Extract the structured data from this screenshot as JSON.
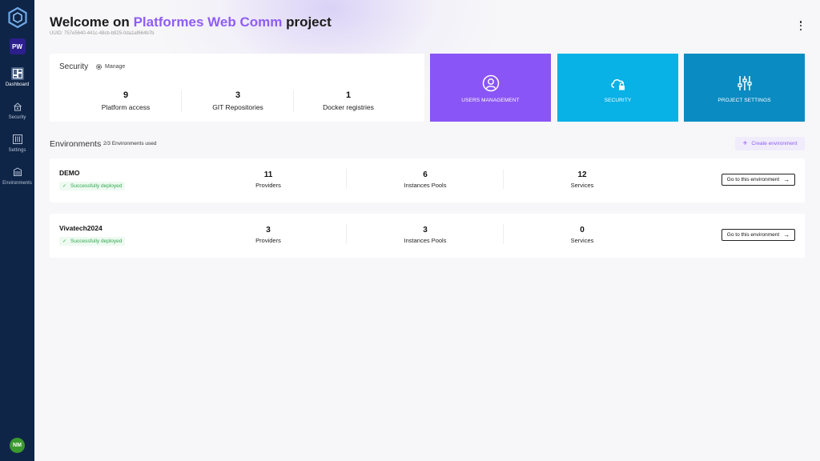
{
  "sidebar": {
    "project_initials": "PW",
    "items": [
      {
        "label": "Dashboard",
        "icon": "dashboard-icon",
        "active": true
      },
      {
        "label": "Security",
        "icon": "lock-icon",
        "active": false
      },
      {
        "label": "Settings",
        "icon": "sliders-icon",
        "active": false
      },
      {
        "label": "Environments",
        "icon": "stack-icon",
        "active": false
      }
    ],
    "user_initials": "NM"
  },
  "header": {
    "welcome_prefix": "Welcome on",
    "project_name": "Platformes Web Comm",
    "welcome_suffix": "project",
    "uuid": "UUID: 757e5640-441c-48cb-b925-0da1af664b7b"
  },
  "security": {
    "title": "Security",
    "manage_label": "Manage",
    "stats": [
      {
        "value": "9",
        "label": "Platform access"
      },
      {
        "value": "3",
        "label": "GIT Repositories"
      },
      {
        "value": "1",
        "label": "Docker registries"
      }
    ]
  },
  "tiles": [
    {
      "label": "USERS MANAGEMENT",
      "icon": "user-circle-icon",
      "color": "#8a55f6"
    },
    {
      "label": "SECURITY",
      "icon": "cloud-lock-icon",
      "color": "#08b1e6"
    },
    {
      "label": "PROJECT SETTINGS",
      "icon": "sliders-icon",
      "color": "#0a8bc1"
    }
  ],
  "environments": {
    "heading": "Environments",
    "used": "2/3 Environments used",
    "create_label": "Create environment",
    "items": [
      {
        "name": "DEMO",
        "status": "Successfully deployed",
        "stats": [
          {
            "value": "11",
            "label": "Providers"
          },
          {
            "value": "6",
            "label": "Instances Pools"
          },
          {
            "value": "12",
            "label": "Services"
          }
        ],
        "go_label": "Go to this environment"
      },
      {
        "name": "Vivatech2024",
        "status": "Successfully deployed",
        "stats": [
          {
            "value": "3",
            "label": "Providers"
          },
          {
            "value": "3",
            "label": "Instances Pools"
          },
          {
            "value": "0",
            "label": "Services"
          }
        ],
        "go_label": "Go to this environment"
      }
    ]
  },
  "colors": {
    "sidebar_bg": "#0f2547",
    "accent_purple": "#8f5cf7",
    "success_green": "#2fa84f"
  }
}
